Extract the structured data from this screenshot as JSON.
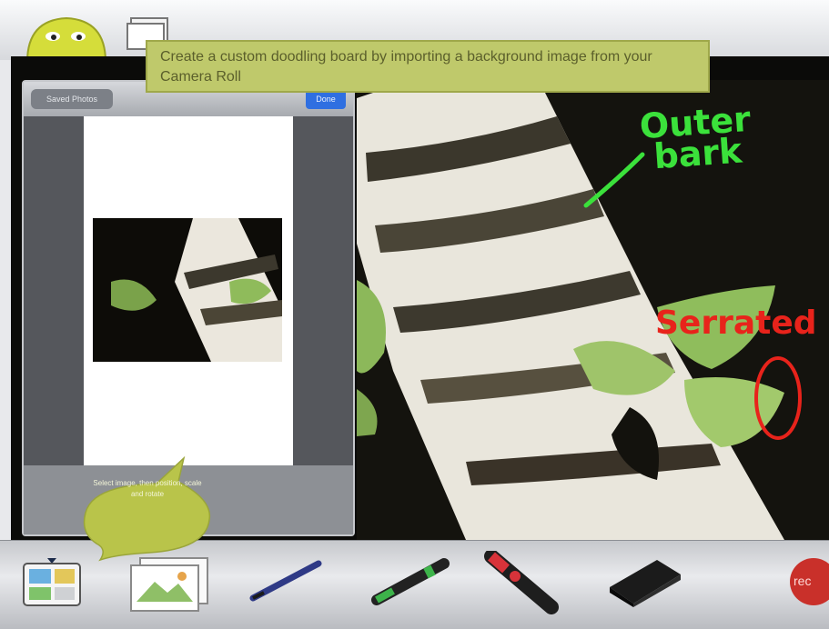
{
  "tip": {
    "text": "Create a custom doodling board by importing a background image from your Camera Roll"
  },
  "picker": {
    "back_label": "Saved Photos",
    "done_label": "Done"
  },
  "bubble": {
    "text": "Select image, then position, scale and rotate"
  },
  "annotations": {
    "outer_bark": "Outer\n bark",
    "serrated": "Serrated"
  },
  "toolbar": {
    "rec_label": "rec",
    "tools": [
      "boards-icon",
      "import-image-icon",
      "pen-icon",
      "marker-icon",
      "highlighter-icon",
      "eraser-icon",
      "record-icon"
    ]
  },
  "colors": {
    "tip_bg": "#bfc96b",
    "annotation_green": "#3be13b",
    "annotation_red": "#e8231b",
    "rec_red": "#c9302a",
    "mascot_yellow": "#d5dd3a"
  }
}
